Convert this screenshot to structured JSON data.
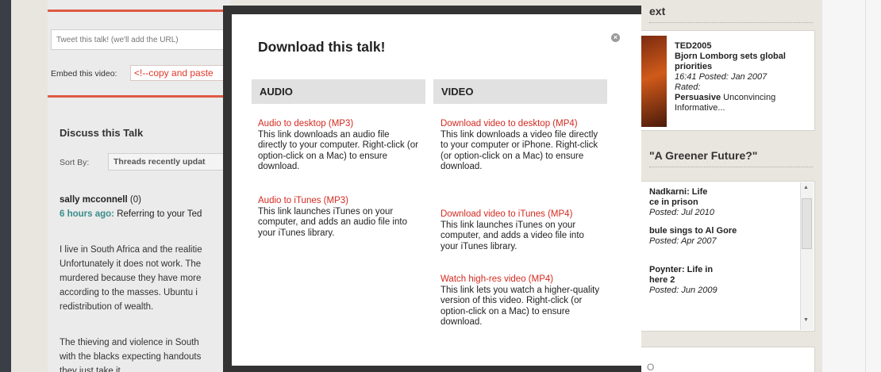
{
  "background": {
    "tweet_placeholder": "Tweet this talk! (we'll add the URL)",
    "embed_label": "Embed this video:",
    "embed_value": "<!--copy and paste",
    "discuss_title": "Discuss this Talk",
    "sort_by_label": "Sort By:",
    "sort_by_value": "Threads recently updat",
    "comment": {
      "author": "sally mcconnell",
      "count": "(0)",
      "time": "6 hours ago:",
      "time_rest": "Referring to your Ted",
      "body_lines": [
        "I live in South Africa and the realitie",
        "Unfortunately it does not work. The",
        "murdered because they have more",
        "according to the masses. Ubuntu i",
        "redistribution of wealth."
      ],
      "body2_lines": [
        "The thieving and violence in South",
        "with the blacks expecting handouts",
        "they just take it"
      ]
    },
    "sidebar": {
      "heading1": "ext",
      "event": "TED2005",
      "talk_title": "Bjorn Lomborg sets global priorities",
      "meta": "16:41 Posted: Jan 2007",
      "rated_label": "Rated:",
      "rated_strong": "Persuasive",
      "rated_rest": "Unconvincing",
      "rated_line2": "Informative...",
      "heading2": "\"A Greener Future?\"",
      "items": [
        {
          "title_lines": [
            "Nadkarni: Life",
            "ce in prison"
          ],
          "meta": "Posted: Jul 2010"
        },
        {
          "title_lines": [
            "bule sings to Al Gore"
          ],
          "meta": "Posted: Apr 2007"
        },
        {
          "title_lines": [
            "Poynter: Life in",
            "here 2"
          ],
          "meta": "Posted: Jun 2009"
        }
      ],
      "card3_text": "O"
    }
  },
  "modal": {
    "title": "Download this talk!",
    "close_glyph": "×",
    "audio": {
      "heading": "AUDIO",
      "items": [
        {
          "link": "Audio to desktop (MP3)",
          "desc": "This link downloads an audio file directly to your computer. Right-click (or option-click on a Mac) to ensure download."
        },
        {
          "link": "Audio to iTunes (MP3)",
          "desc": "This link launches iTunes on your computer, and adds an audio file into your iTunes library."
        }
      ]
    },
    "video": {
      "heading": "VIDEO",
      "items": [
        {
          "link": "Download video to desktop (MP4)",
          "desc": "This link downloads a video file directly to your computer or iPhone. Right-click (or option-click on a Mac) to ensure download."
        },
        {
          "link": "Download video to iTunes (MP4)",
          "desc": "This link launches iTunes on your computer, and adds a video file into your iTunes library."
        },
        {
          "link": "Watch high-res video (MP4)",
          "desc": "This link lets you watch a higher-quality version of this video. Right-click (or option-click on a Mac) to ensure download."
        }
      ]
    }
  },
  "colors": {
    "accent_red": "#e05a45",
    "link_red": "#d42a20",
    "time_teal": "#3a8d8a",
    "overlay_dark": "#333333"
  }
}
